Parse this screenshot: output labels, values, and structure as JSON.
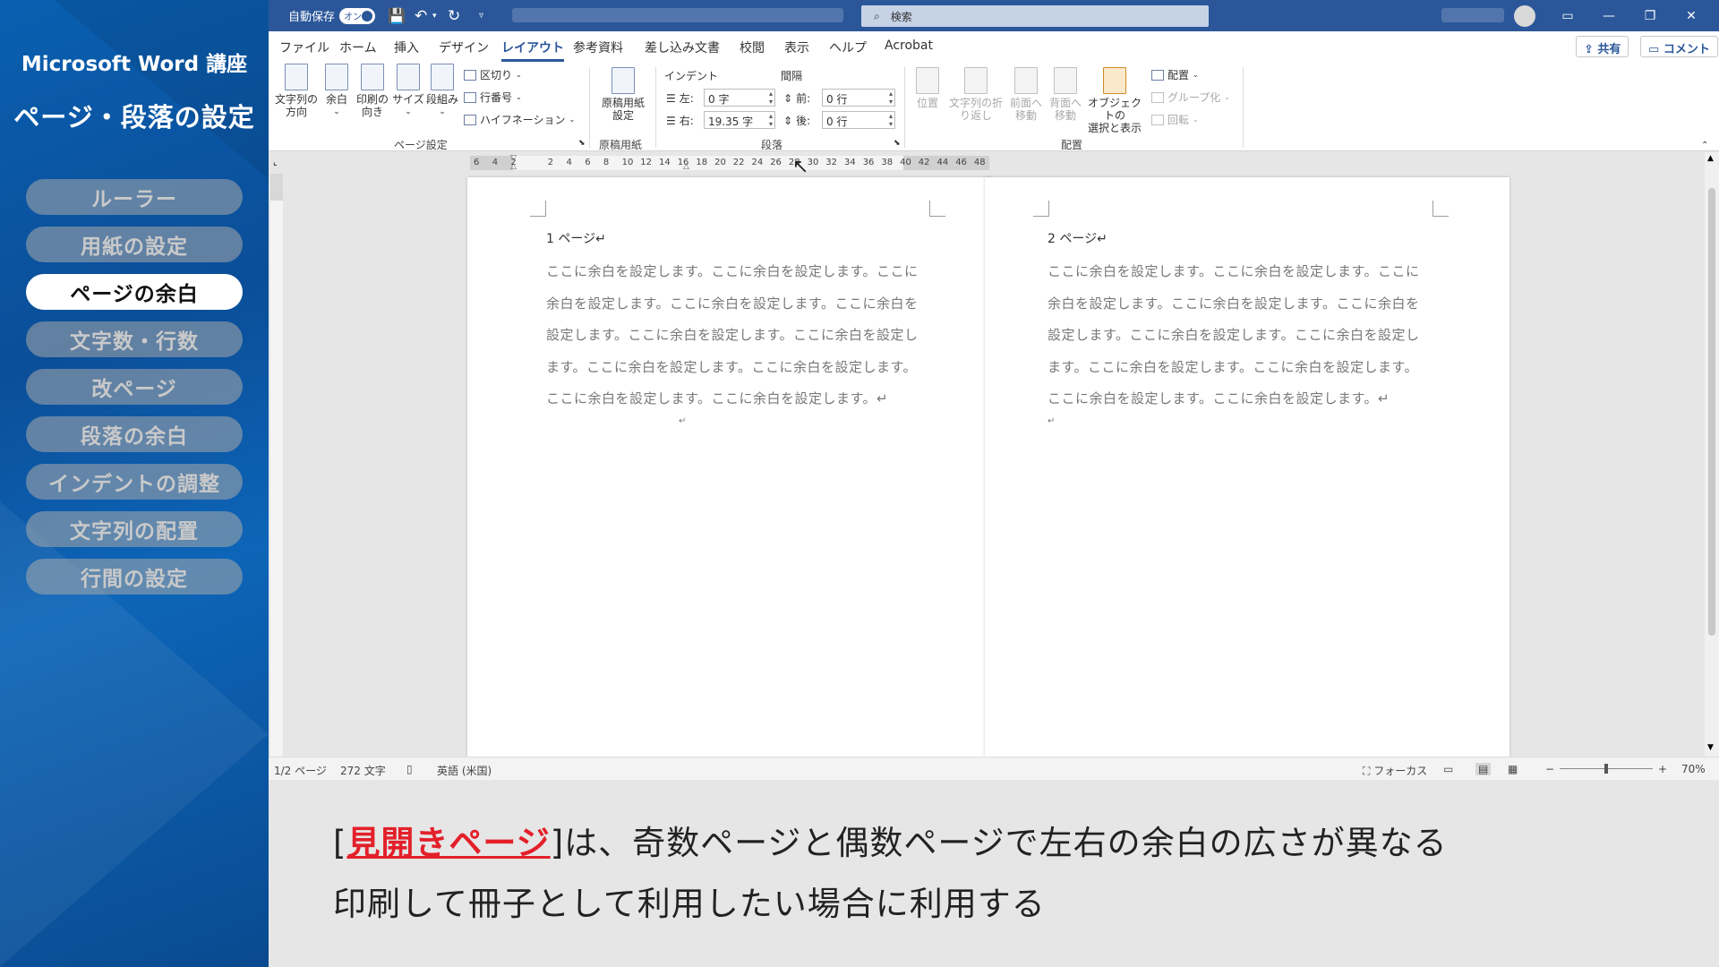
{
  "course": {
    "title": "Microsoft Word 講座",
    "subtitle": "ページ・段落の設定",
    "items": [
      "ルーラー",
      "用紙の設定",
      "ページの余白",
      "文字数・行数",
      "改ページ",
      "段落の余白",
      "インデントの調整",
      "文字列の配置",
      "行間の設定"
    ],
    "active_index": 2
  },
  "titlebar": {
    "autosave_label": "自動保存",
    "autosave_state": "オン",
    "search_placeholder": "検索",
    "qat": [
      "save-icon",
      "undo-icon",
      "redo-icon",
      "customize-icon"
    ]
  },
  "menu": {
    "tabs": [
      "ファイル",
      "ホーム",
      "挿入",
      "デザイン",
      "レイアウト",
      "参考資料",
      "差し込み文書",
      "校閲",
      "表示",
      "ヘルプ",
      "Acrobat"
    ],
    "active": "レイアウト",
    "share": "共有",
    "comment": "コメント"
  },
  "ribbon": {
    "page_setup": {
      "label": "ページ設定",
      "text_direction": "文字列の\n方向",
      "margins": "余白",
      "orientation": "印刷の\n向き",
      "size": "サイズ",
      "columns": "段組み",
      "breaks": "区切り",
      "line_numbers": "行番号",
      "hyphenation": "ハイフネーション"
    },
    "manuscript": {
      "label": "原稿用紙",
      "button": "原稿用紙\n設定"
    },
    "paragraph": {
      "label": "段落",
      "indent_label": "インデント",
      "spacing_label": "間隔",
      "left_label": "左:",
      "left_value": "0 字",
      "right_label": "右:",
      "right_value": "19.35 字",
      "before_label": "前:",
      "before_value": "0 行",
      "after_label": "後:",
      "after_value": "0 行"
    },
    "arrange": {
      "label": "配置",
      "position": "位置",
      "wrap": "文字列の折\nり返し",
      "forward": "前面へ\n移動",
      "backward": "背面へ\n移動",
      "selection": "オブジェクトの\n選択と表示",
      "align": "配置",
      "group": "グループ化",
      "rotate": "回転"
    }
  },
  "ruler": {
    "ticks": [
      "6",
      "4",
      "2",
      "",
      "2",
      "4",
      "6",
      "8",
      "10",
      "12",
      "14",
      "16",
      "18",
      "20",
      "22",
      "24",
      "26",
      "28",
      "30",
      "32",
      "34",
      "36",
      "38",
      "40",
      "42",
      "44",
      "46",
      "48"
    ]
  },
  "pages": [
    {
      "heading": "1 ページ↵",
      "lines": [
        "ここに余白を設定します。ここに余白を設定します。ここに",
        "余白を設定します。ここに余白を設定します。ここに余白を",
        "設定します。ここに余白を設定します。ここに余白を設定し",
        "ます。ここに余白を設定します。ここに余白を設定します。",
        "ここに余白を設定します。ここに余白を設定します。↵",
        "↵"
      ]
    },
    {
      "heading": "2 ページ↵",
      "lines": [
        "ここに余白を設定します。ここに余白を設定します。ここに",
        "余白を設定します。ここに余白を設定します。ここに余白を",
        "設定します。ここに余白を設定します。ここに余白を設定し",
        "ます。ここに余白を設定します。ここに余白を設定します。",
        "ここに余白を設定します。ここに余白を設定します。↵",
        "↵"
      ]
    }
  ],
  "status": {
    "page": "1/2 ページ",
    "words": "272 文字",
    "language": "英語 (米国)",
    "focus": "フォーカス",
    "zoom": "70%",
    "zoom_minus": "−",
    "zoom_plus": "+"
  },
  "caption": {
    "line1_prefix": "[",
    "line1_highlight": "見開きページ",
    "line1_rest": "]は、奇数ページと偶数ページで左右の余白の広さが異なる",
    "line2": "印刷して冊子として利用したい場合に利用する"
  },
  "colors": {
    "title_bar": "#2b579a",
    "sidebar": "#0b5aa8",
    "highlight": "#e3202a"
  }
}
